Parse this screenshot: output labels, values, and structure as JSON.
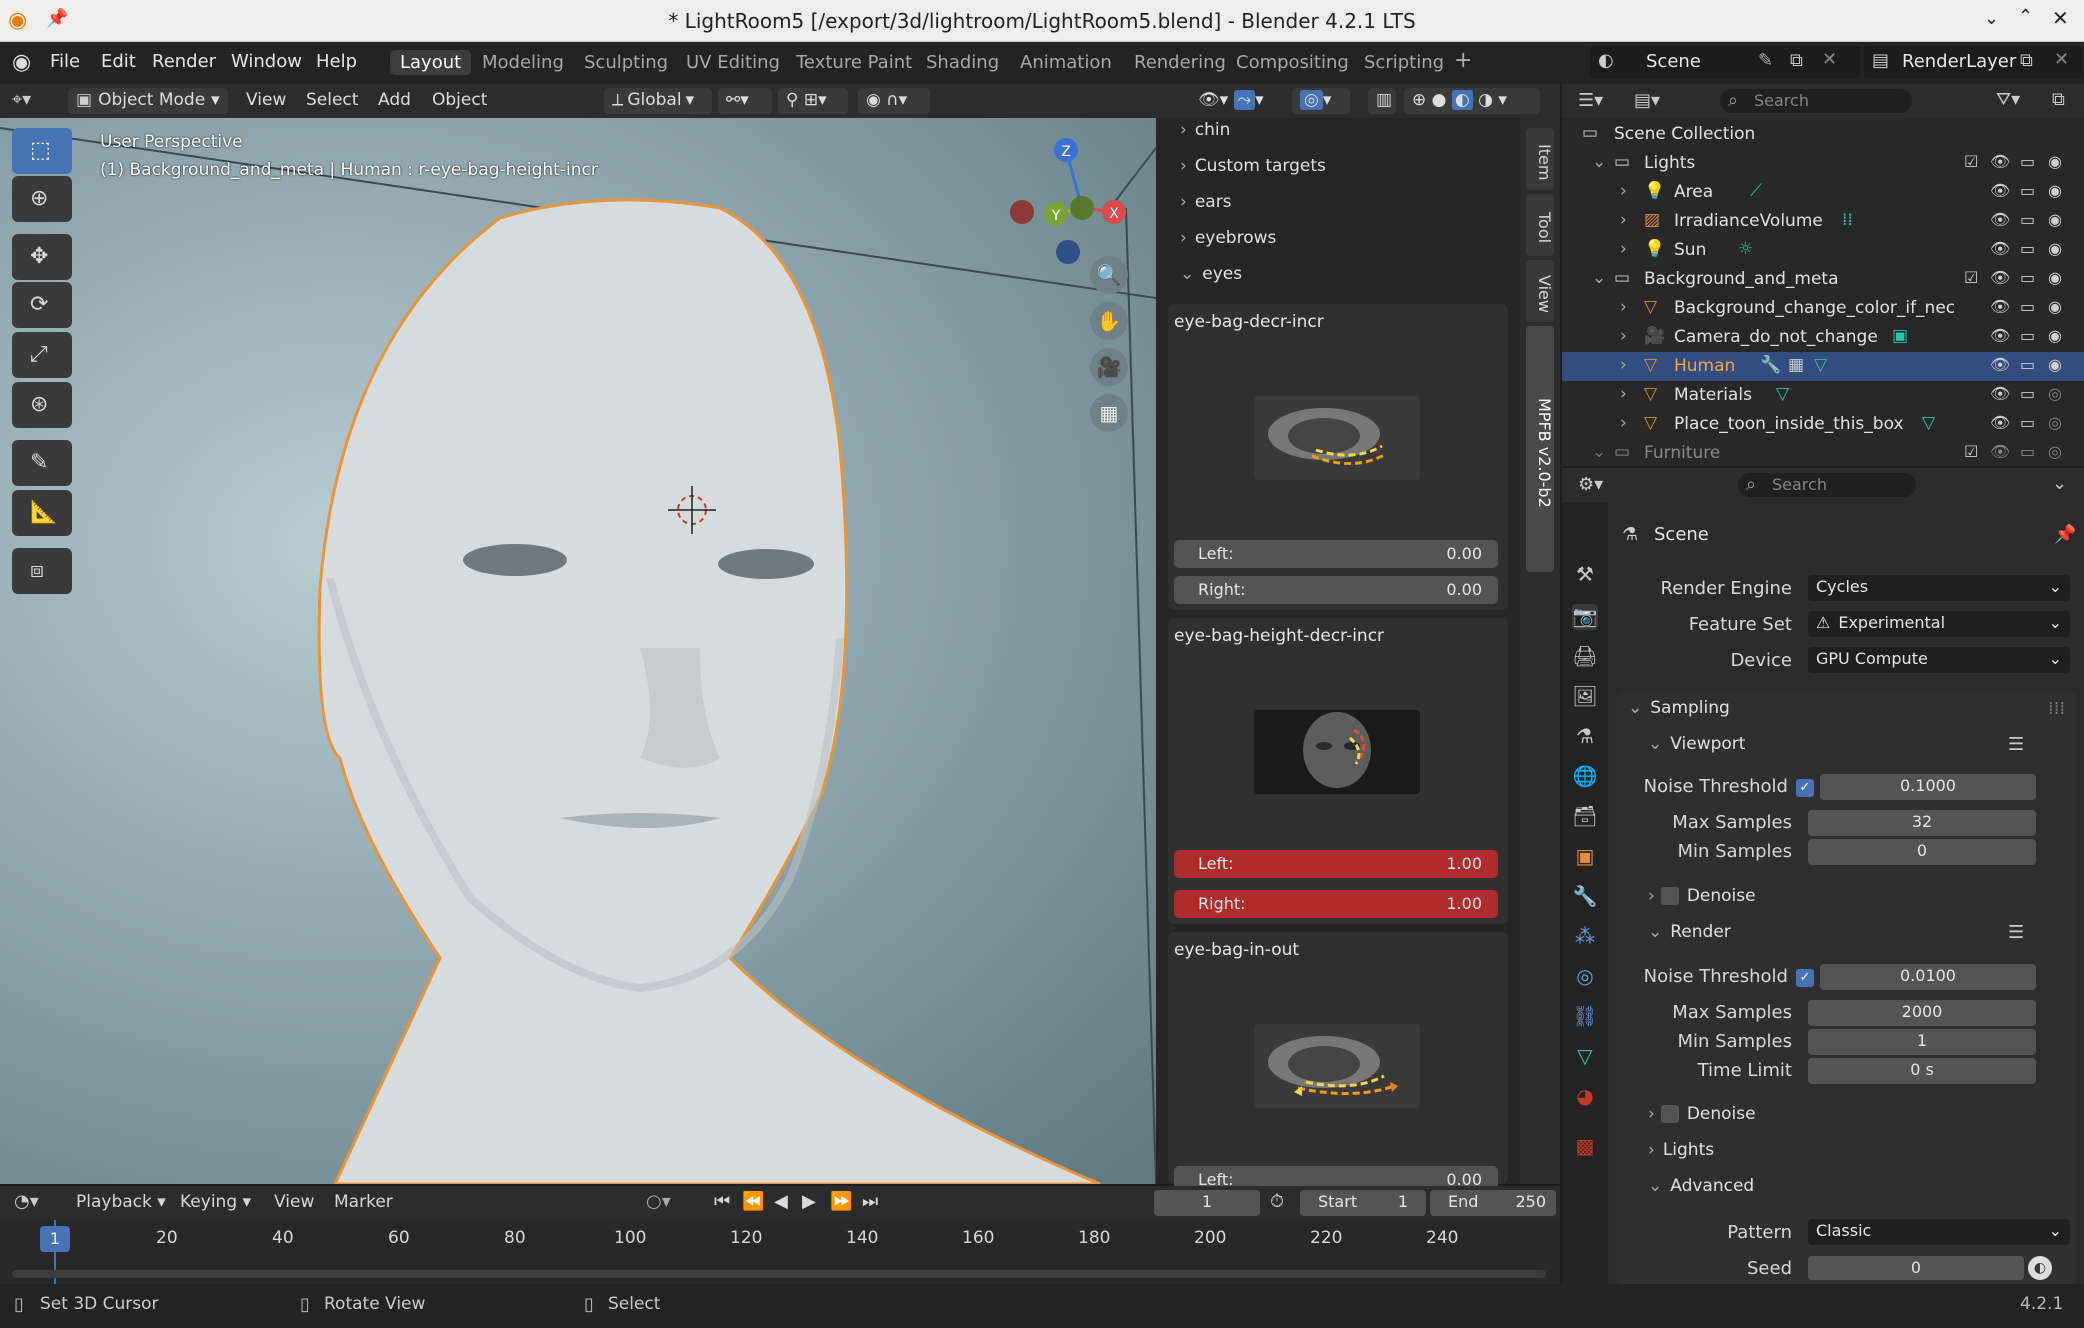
{
  "window": {
    "title": "* LightRoom5 [/export/3d/lightroom/LightRoom5.blend] - Blender 4.2.1 LTS"
  },
  "menu": {
    "file": "File",
    "edit": "Edit",
    "render": "Render",
    "window": "Window",
    "help": "Help"
  },
  "workspaces": [
    "Layout",
    "Modeling",
    "Sculpting",
    "UV Editing",
    "Texture Paint",
    "Shading",
    "Animation",
    "Rendering",
    "Compositing",
    "Scripting"
  ],
  "scene": {
    "name": "Scene",
    "view_layer": "RenderLayer"
  },
  "viewport_header": {
    "mode": "Object Mode",
    "view": "View",
    "select": "Select",
    "add": "Add",
    "object": "Object",
    "orientation": "Global"
  },
  "viewport": {
    "perspective": "User Perspective",
    "object_info": "(1) Background_and_meta | Human : r-eye-bag-height-incr"
  },
  "gizmo": {
    "x": "X",
    "y": "Y",
    "z": "Z"
  },
  "npanel": {
    "collapsed": [
      "chin",
      "Custom targets",
      "ears",
      "eyebrows"
    ],
    "expanded": "eyes",
    "cards": [
      {
        "name": "eye-bag-decr-incr",
        "left_label": "Left:",
        "left": "0.00",
        "right_label": "Right:",
        "right": "0.00"
      },
      {
        "name": "eye-bag-height-decr-incr",
        "left_label": "Left:",
        "left": "1.00",
        "right_label": "Right:",
        "right": "1.00"
      },
      {
        "name": "eye-bag-in-out",
        "left_label": "Left:",
        "left": "0.00"
      }
    ]
  },
  "side_tabs": [
    "Item",
    "Tool",
    "View",
    "MPFB v2.0-b2"
  ],
  "outliner": {
    "search_placeholder": "Search",
    "root": "Scene Collection",
    "rows": [
      "Lights",
      "Area",
      "IrradianceVolume",
      "Sun",
      "Background_and_meta",
      "Background_change_color_if_neces",
      "Camera_do_not_change",
      "Human",
      "Materials",
      "Place_toon_inside_this_box",
      "Furniture"
    ]
  },
  "properties": {
    "search_placeholder": "Search",
    "context": "Scene",
    "render_engine_label": "Render Engine",
    "render_engine": "Cycles",
    "feature_set_label": "Feature Set",
    "feature_set": "Experimental",
    "device_label": "Device",
    "device": "GPU Compute",
    "sampling": "Sampling",
    "viewport": "Viewport",
    "noise_threshold_label": "Noise Threshold",
    "vp_noise": "0.1000",
    "max_samples_label": "Max Samples",
    "vp_max": "32",
    "min_samples_label": "Min Samples",
    "vp_min": "0",
    "denoise": "Denoise",
    "render": "Render",
    "r_noise": "0.0100",
    "r_max": "2000",
    "r_min": "1",
    "time_limit_label": "Time Limit",
    "r_time": "0 s",
    "lights": "Lights",
    "advanced": "Advanced",
    "pattern_label": "Pattern",
    "pattern": "Classic",
    "seed_label": "Seed",
    "seed": "0"
  },
  "timeline": {
    "playback": "Playback",
    "keying": "Keying",
    "view": "View",
    "marker": "Marker",
    "current_frame": "1",
    "start_label": "Start",
    "start": "1",
    "end_label": "End",
    "end": "250",
    "ticks": [
      "20",
      "40",
      "60",
      "80",
      "100",
      "120",
      "140",
      "160",
      "180",
      "200",
      "220",
      "240"
    ],
    "cursor": "1"
  },
  "status": {
    "left": "Set 3D Cursor",
    "middle": "Rotate View",
    "right": "Select",
    "version": "4.2.1"
  }
}
